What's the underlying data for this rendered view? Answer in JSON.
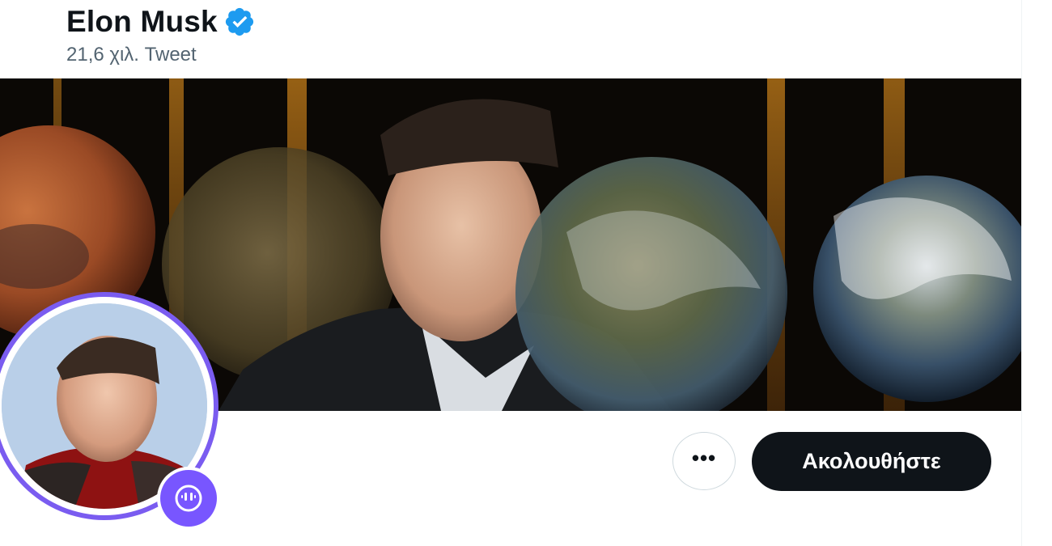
{
  "profile": {
    "display_name": "Elon Musk",
    "verified": true,
    "tweet_count": "21,6 χιλ. Tweet"
  },
  "banner": {
    "description_icon": "banner-image"
  },
  "avatar": {
    "icon": "avatar-photo",
    "badge_icon": "spaces-icon"
  },
  "actions": {
    "more_icon": "more-icon",
    "more_label": "•••",
    "follow_label": "Ακολουθήστε"
  },
  "colors": {
    "accent": "#7856ff",
    "verified_blue": "#1d9bf0",
    "button_dark": "#0f1419",
    "secondary_text": "#536471"
  }
}
